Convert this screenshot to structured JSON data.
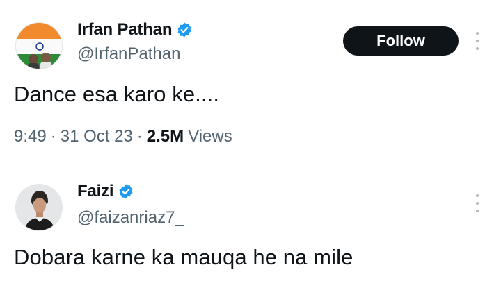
{
  "colors": {
    "text_primary": "#0f1419",
    "text_secondary": "#536471",
    "verified_blue": "#1d9bf0",
    "follow_button_bg": "#0f1419"
  },
  "tweet": {
    "author": {
      "display_name": "Irfan Pathan",
      "handle": "@IrfanPathan",
      "verified": true,
      "avatar_icon": "avatar-india-flag-icon"
    },
    "follow_label": "Follow",
    "text": "Dance esa karo ke....",
    "time": "9:49",
    "date": "31 Oct 23",
    "views_count": "2.5M",
    "views_label": "Views"
  },
  "reply": {
    "author": {
      "display_name": "Faizi",
      "handle": "@faizanriaz7_",
      "verified": true,
      "avatar_icon": "avatar-portrait-icon"
    },
    "text": "Dobara karne ka mauqa he na mile"
  }
}
